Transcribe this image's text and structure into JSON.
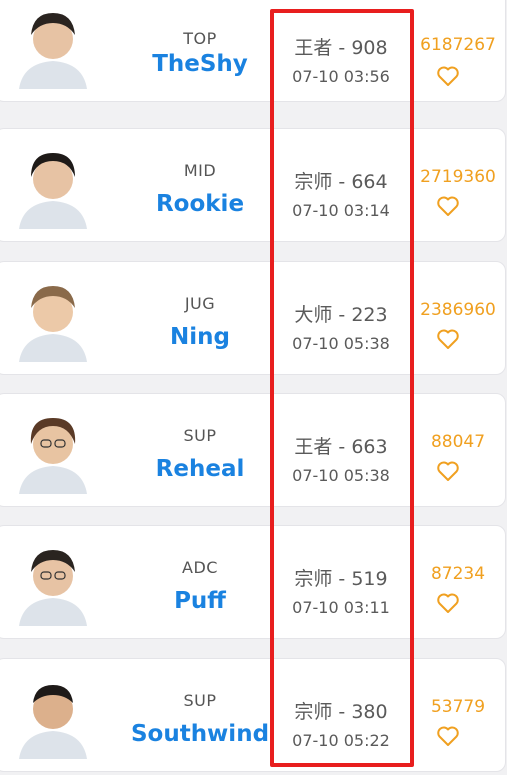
{
  "players": [
    {
      "position": "TOP",
      "name": "TheShy",
      "rank": "王者 - 908",
      "time": "07-10 03:56",
      "score": "6187267"
    },
    {
      "position": "MID",
      "name": "Rookie",
      "rank": "宗师 - 664",
      "time": "07-10 03:14",
      "score": "2719360"
    },
    {
      "position": "JUG",
      "name": "Ning",
      "rank": "大师 - 223",
      "time": "07-10 05:38",
      "score": "2386960"
    },
    {
      "position": "SUP",
      "name": "Reheal",
      "rank": "王者 - 663",
      "time": "07-10 05:38",
      "score": "88047"
    },
    {
      "position": "ADC",
      "name": "Puff",
      "rank": "宗师 - 519",
      "time": "07-10 03:11",
      "score": "87234"
    },
    {
      "position": "SUP",
      "name": "Southwind",
      "rank": "宗师 - 380",
      "time": "07-10 05:22",
      "score": "53779"
    }
  ],
  "icons": {
    "favorite": "heart-outline-icon",
    "player_photo": "avatar"
  },
  "colors": {
    "name": "#1a82e0",
    "score": "#f0a020",
    "highlight": "#e81e1e",
    "text": "#5a5a5a"
  }
}
